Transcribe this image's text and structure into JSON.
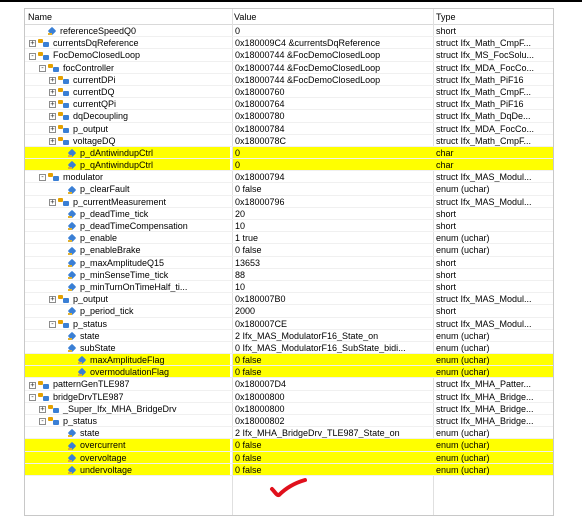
{
  "columns": {
    "name": "Name",
    "value": "Value",
    "type": "Type"
  },
  "rows": [
    {
      "depth": 1,
      "kind": "var",
      "expander": "",
      "name": "referenceSpeedQ0",
      "value": "0",
      "type": "short",
      "hl": false
    },
    {
      "depth": 0,
      "kind": "struct",
      "expander": "+",
      "name": "currentsDqReference",
      "value": "0x180009C4 &currentsDqReference",
      "type": "struct Ifx_Math_CmpF...",
      "hl": false
    },
    {
      "depth": 0,
      "kind": "struct",
      "expander": "-",
      "name": "FocDemoClosedLoop",
      "value": "0x18000744 &FocDemoClosedLoop",
      "type": "struct Ifx_MS_FocSolu...",
      "hl": false
    },
    {
      "depth": 1,
      "kind": "struct",
      "expander": "-",
      "name": "focController",
      "value": "0x18000744 &FocDemoClosedLoop",
      "type": "struct Ifx_MDA_FocCo...",
      "hl": false
    },
    {
      "depth": 2,
      "kind": "struct",
      "expander": "+",
      "name": "currentDPi",
      "value": "0x18000744 &FocDemoClosedLoop",
      "type": "struct Ifx_Math_PiF16",
      "hl": false
    },
    {
      "depth": 2,
      "kind": "struct",
      "expander": "+",
      "name": "currentDQ",
      "value": "0x18000760",
      "type": "struct Ifx_Math_CmpF...",
      "hl": false
    },
    {
      "depth": 2,
      "kind": "struct",
      "expander": "+",
      "name": "currentQPi",
      "value": "0x18000764",
      "type": "struct Ifx_Math_PiF16",
      "hl": false
    },
    {
      "depth": 2,
      "kind": "struct",
      "expander": "+",
      "name": "dqDecoupling",
      "value": "0x18000780",
      "type": "struct Ifx_Math_DqDe...",
      "hl": false
    },
    {
      "depth": 2,
      "kind": "struct",
      "expander": "+",
      "name": "p_output",
      "value": "0x18000784",
      "type": "struct Ifx_MDA_FocCo...",
      "hl": false
    },
    {
      "depth": 2,
      "kind": "struct",
      "expander": "+",
      "name": "voltageDQ",
      "value": "0x1800078C",
      "type": "struct Ifx_Math_CmpF...",
      "hl": false
    },
    {
      "depth": 3,
      "kind": "var",
      "expander": "",
      "name": "p_dAntiwindupCtrl",
      "value": "0",
      "type": "char",
      "hl": true
    },
    {
      "depth": 3,
      "kind": "var",
      "expander": "",
      "name": "p_qAntiwindupCtrl",
      "value": "0",
      "type": "char",
      "hl": true
    },
    {
      "depth": 1,
      "kind": "struct",
      "expander": "-",
      "name": "modulator",
      "value": "0x18000794",
      "type": "struct Ifx_MAS_Modul...",
      "hl": false
    },
    {
      "depth": 3,
      "kind": "var",
      "expander": "",
      "name": "p_clearFault",
      "value": "0 false",
      "type": "enum (uchar)",
      "hl": false
    },
    {
      "depth": 2,
      "kind": "struct",
      "expander": "+",
      "name": "p_currentMeasurement",
      "value": "0x18000796",
      "type": "struct Ifx_MAS_Modul...",
      "hl": false
    },
    {
      "depth": 3,
      "kind": "var",
      "expander": "",
      "name": "p_deadTime_tick",
      "value": "20",
      "type": "short",
      "hl": false
    },
    {
      "depth": 3,
      "kind": "var",
      "expander": "",
      "name": "p_deadTimeCompensation",
      "value": "10",
      "type": "short",
      "hl": false
    },
    {
      "depth": 3,
      "kind": "var",
      "expander": "",
      "name": "p_enable",
      "value": "1 true",
      "type": "enum (uchar)",
      "hl": false
    },
    {
      "depth": 3,
      "kind": "var",
      "expander": "",
      "name": "p_enableBrake",
      "value": "0 false",
      "type": "enum (uchar)",
      "hl": false
    },
    {
      "depth": 3,
      "kind": "var",
      "expander": "",
      "name": "p_maxAmplitudeQ15",
      "value": "13653",
      "type": "short",
      "hl": false
    },
    {
      "depth": 3,
      "kind": "var",
      "expander": "",
      "name": "p_minSenseTime_tick",
      "value": "88",
      "type": "short",
      "hl": false
    },
    {
      "depth": 3,
      "kind": "var",
      "expander": "",
      "name": "p_minTurnOnTimeHalf_ti...",
      "value": "10",
      "type": "short",
      "hl": false
    },
    {
      "depth": 2,
      "kind": "struct",
      "expander": "+",
      "name": "p_output",
      "value": "0x180007B0",
      "type": "struct Ifx_MAS_Modul...",
      "hl": false
    },
    {
      "depth": 3,
      "kind": "var",
      "expander": "",
      "name": "p_period_tick",
      "value": "2000",
      "type": "short",
      "hl": false
    },
    {
      "depth": 2,
      "kind": "struct",
      "expander": "-",
      "name": "p_status",
      "value": "0x180007CE",
      "type": "struct Ifx_MAS_Modul...",
      "hl": false
    },
    {
      "depth": 3,
      "kind": "var",
      "expander": "",
      "name": "state",
      "value": "2 Ifx_MAS_ModulatorF16_State_on",
      "type": "enum (uchar)",
      "hl": false
    },
    {
      "depth": 3,
      "kind": "var",
      "expander": "",
      "name": "subState",
      "value": "0 Ifx_MAS_ModulatorF16_SubState_bidi...",
      "type": "enum (uchar)",
      "hl": false
    },
    {
      "depth": 4,
      "kind": "var",
      "expander": "",
      "name": "maxAmplitudeFlag",
      "value": "0 false",
      "type": "enum (uchar)",
      "hl": true
    },
    {
      "depth": 4,
      "kind": "var",
      "expander": "",
      "name": "overmodulationFlag",
      "value": "0 false",
      "type": "enum (uchar)",
      "hl": true
    },
    {
      "depth": 0,
      "kind": "struct",
      "expander": "+",
      "name": "patternGenTLE987",
      "value": "0x180007D4",
      "type": "struct Ifx_MHA_Patter...",
      "hl": false
    },
    {
      "depth": 0,
      "kind": "struct",
      "expander": "-",
      "name": "bridgeDrvTLE987",
      "value": "0x18000800",
      "type": "struct Ifx_MHA_Bridge...",
      "hl": false
    },
    {
      "depth": 1,
      "kind": "struct",
      "expander": "+",
      "name": "_Super_Ifx_MHA_BridgeDrv",
      "value": "0x18000800",
      "type": "struct Ifx_MHA_Bridge...",
      "hl": false
    },
    {
      "depth": 1,
      "kind": "struct",
      "expander": "-",
      "name": "p_status",
      "value": "0x18000802",
      "type": "struct Ifx_MHA_Bridge...",
      "hl": false
    },
    {
      "depth": 3,
      "kind": "var",
      "expander": "",
      "name": "state",
      "value": "2 Ifx_MHA_BridgeDrv_TLE987_State_on",
      "type": "enum (uchar)",
      "hl": false
    },
    {
      "depth": 3,
      "kind": "var",
      "expander": "",
      "name": "overcurrent",
      "value": "0 false",
      "type": "enum (uchar)",
      "hl": true
    },
    {
      "depth": 3,
      "kind": "var",
      "expander": "",
      "name": "overvoltage",
      "value": "0 false",
      "type": "enum (uchar)",
      "hl": true
    },
    {
      "depth": 3,
      "kind": "var",
      "expander": "",
      "name": "undervoltage",
      "value": "0 false",
      "type": "enum (uchar)",
      "hl": true
    }
  ],
  "colors": {
    "highlight": "#ffff00",
    "annotation": "#e0101c"
  }
}
